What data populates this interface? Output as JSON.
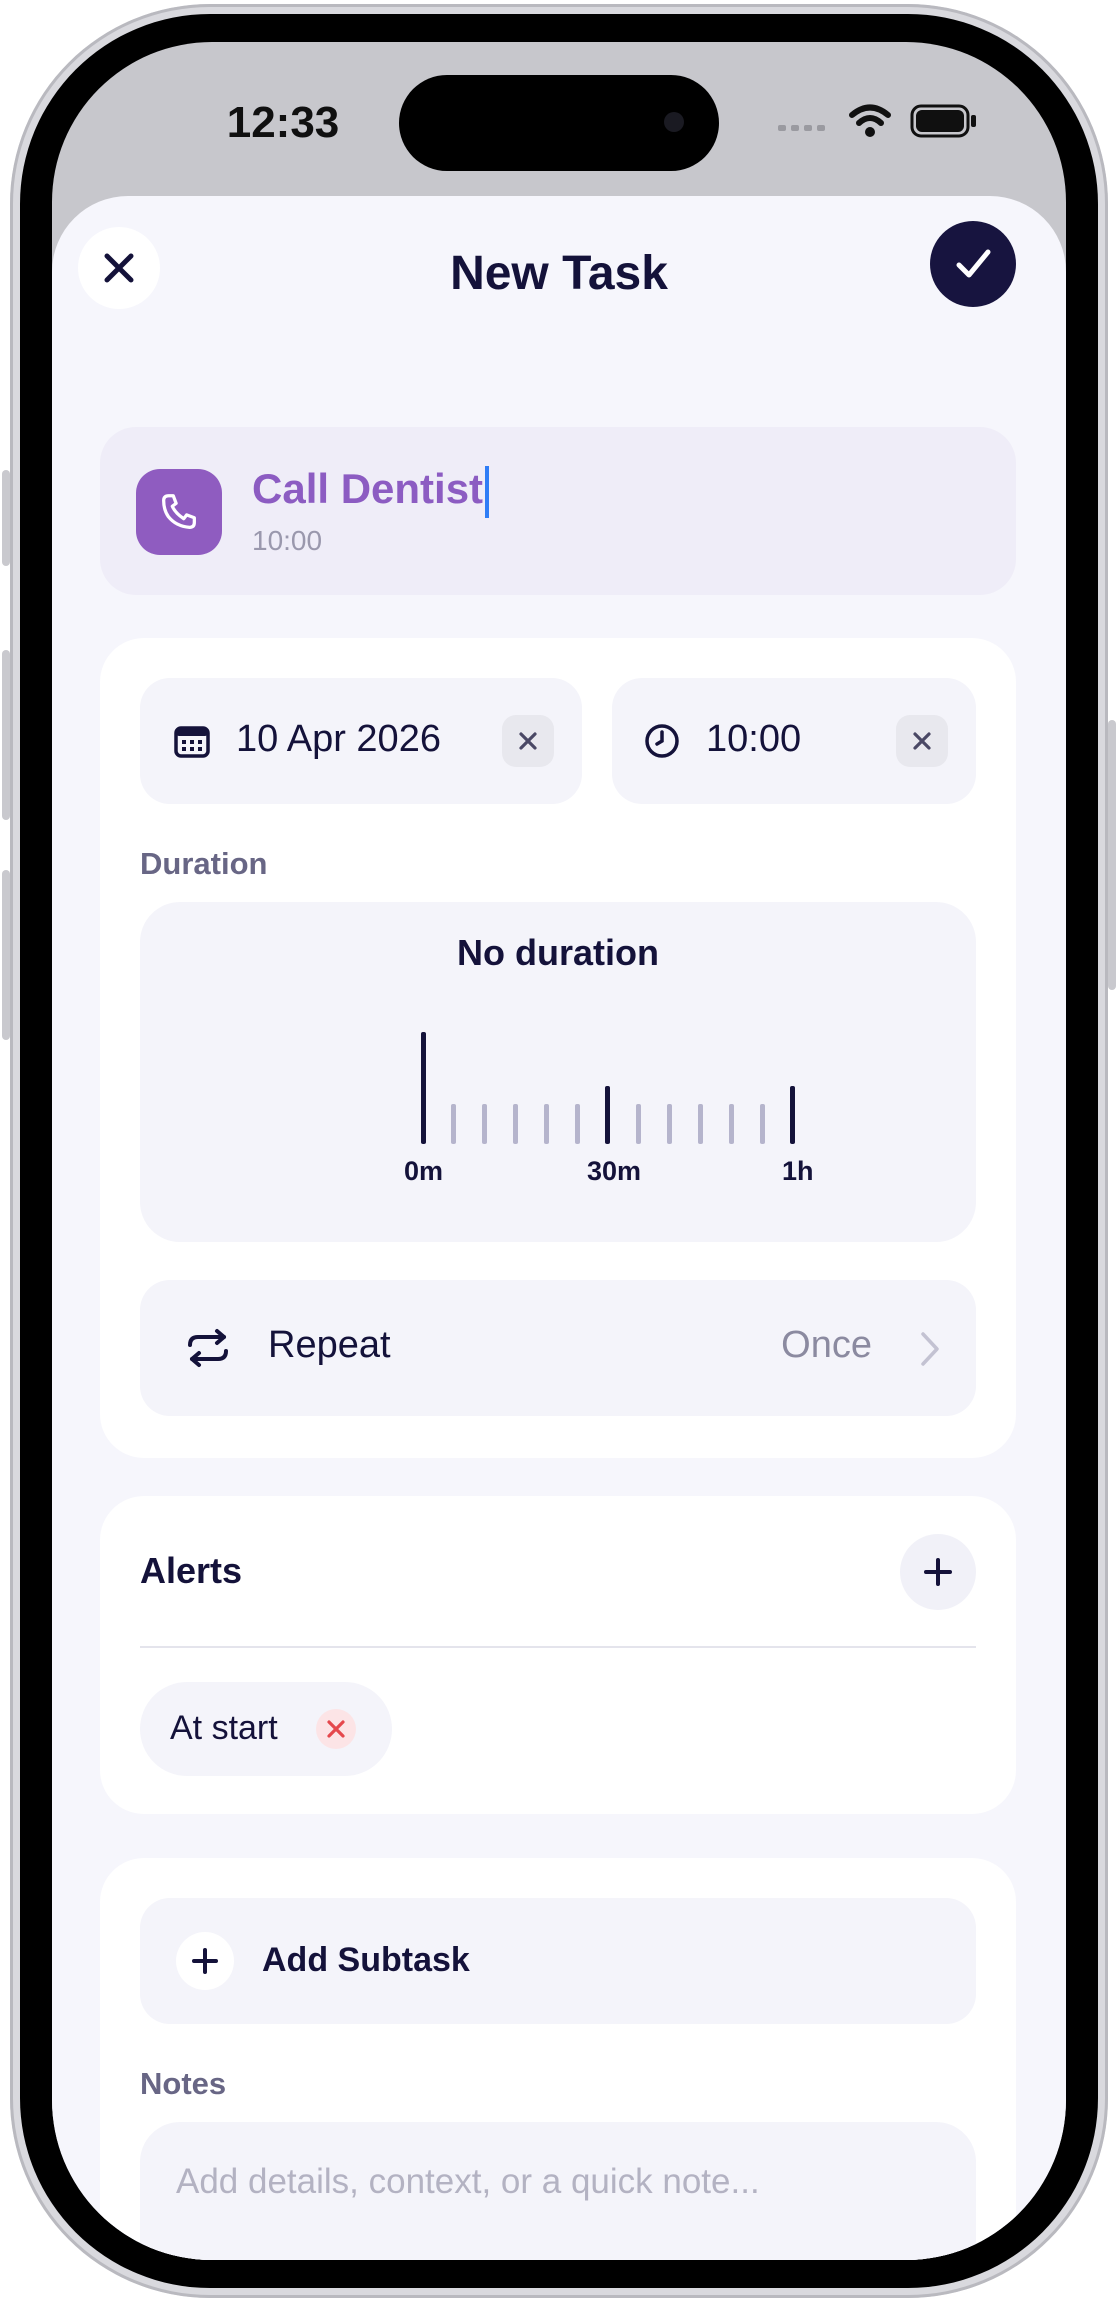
{
  "status_bar": {
    "time": "12:33"
  },
  "header": {
    "title": "New Task"
  },
  "task": {
    "name": "Call Dentist",
    "time": "10:00"
  },
  "schedule": {
    "date": "10 Apr 2026",
    "time": "10:00"
  },
  "duration": {
    "label": "Duration",
    "value": "No duration",
    "tick_labels": [
      "0m",
      "30m",
      "1h"
    ]
  },
  "repeat": {
    "label": "Repeat",
    "value": "Once"
  },
  "alerts": {
    "title": "Alerts",
    "items": [
      "At start"
    ]
  },
  "subtask": {
    "add_label": "Add Subtask"
  },
  "notes": {
    "label": "Notes",
    "placeholder": "Add details, context, or a quick note..."
  },
  "colors": {
    "accent": "#8f5cc0",
    "primary_dark": "#14123a",
    "remove_red": "#e5484d",
    "sheet_bg": "#f6f6fc"
  },
  "icons": [
    "close-icon",
    "checkmark-icon",
    "phone-icon",
    "calendar-icon",
    "clock-icon",
    "repeat-icon",
    "chevron-right-icon",
    "plus-icon"
  ]
}
